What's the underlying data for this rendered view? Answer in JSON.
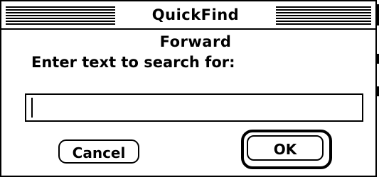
{
  "dialog": {
    "title": "QuickFind Forward",
    "prompt": "Enter text to search for:",
    "search_value": "",
    "cancel_label": "Cancel",
    "ok_label": "OK",
    "default_button": "OK"
  }
}
